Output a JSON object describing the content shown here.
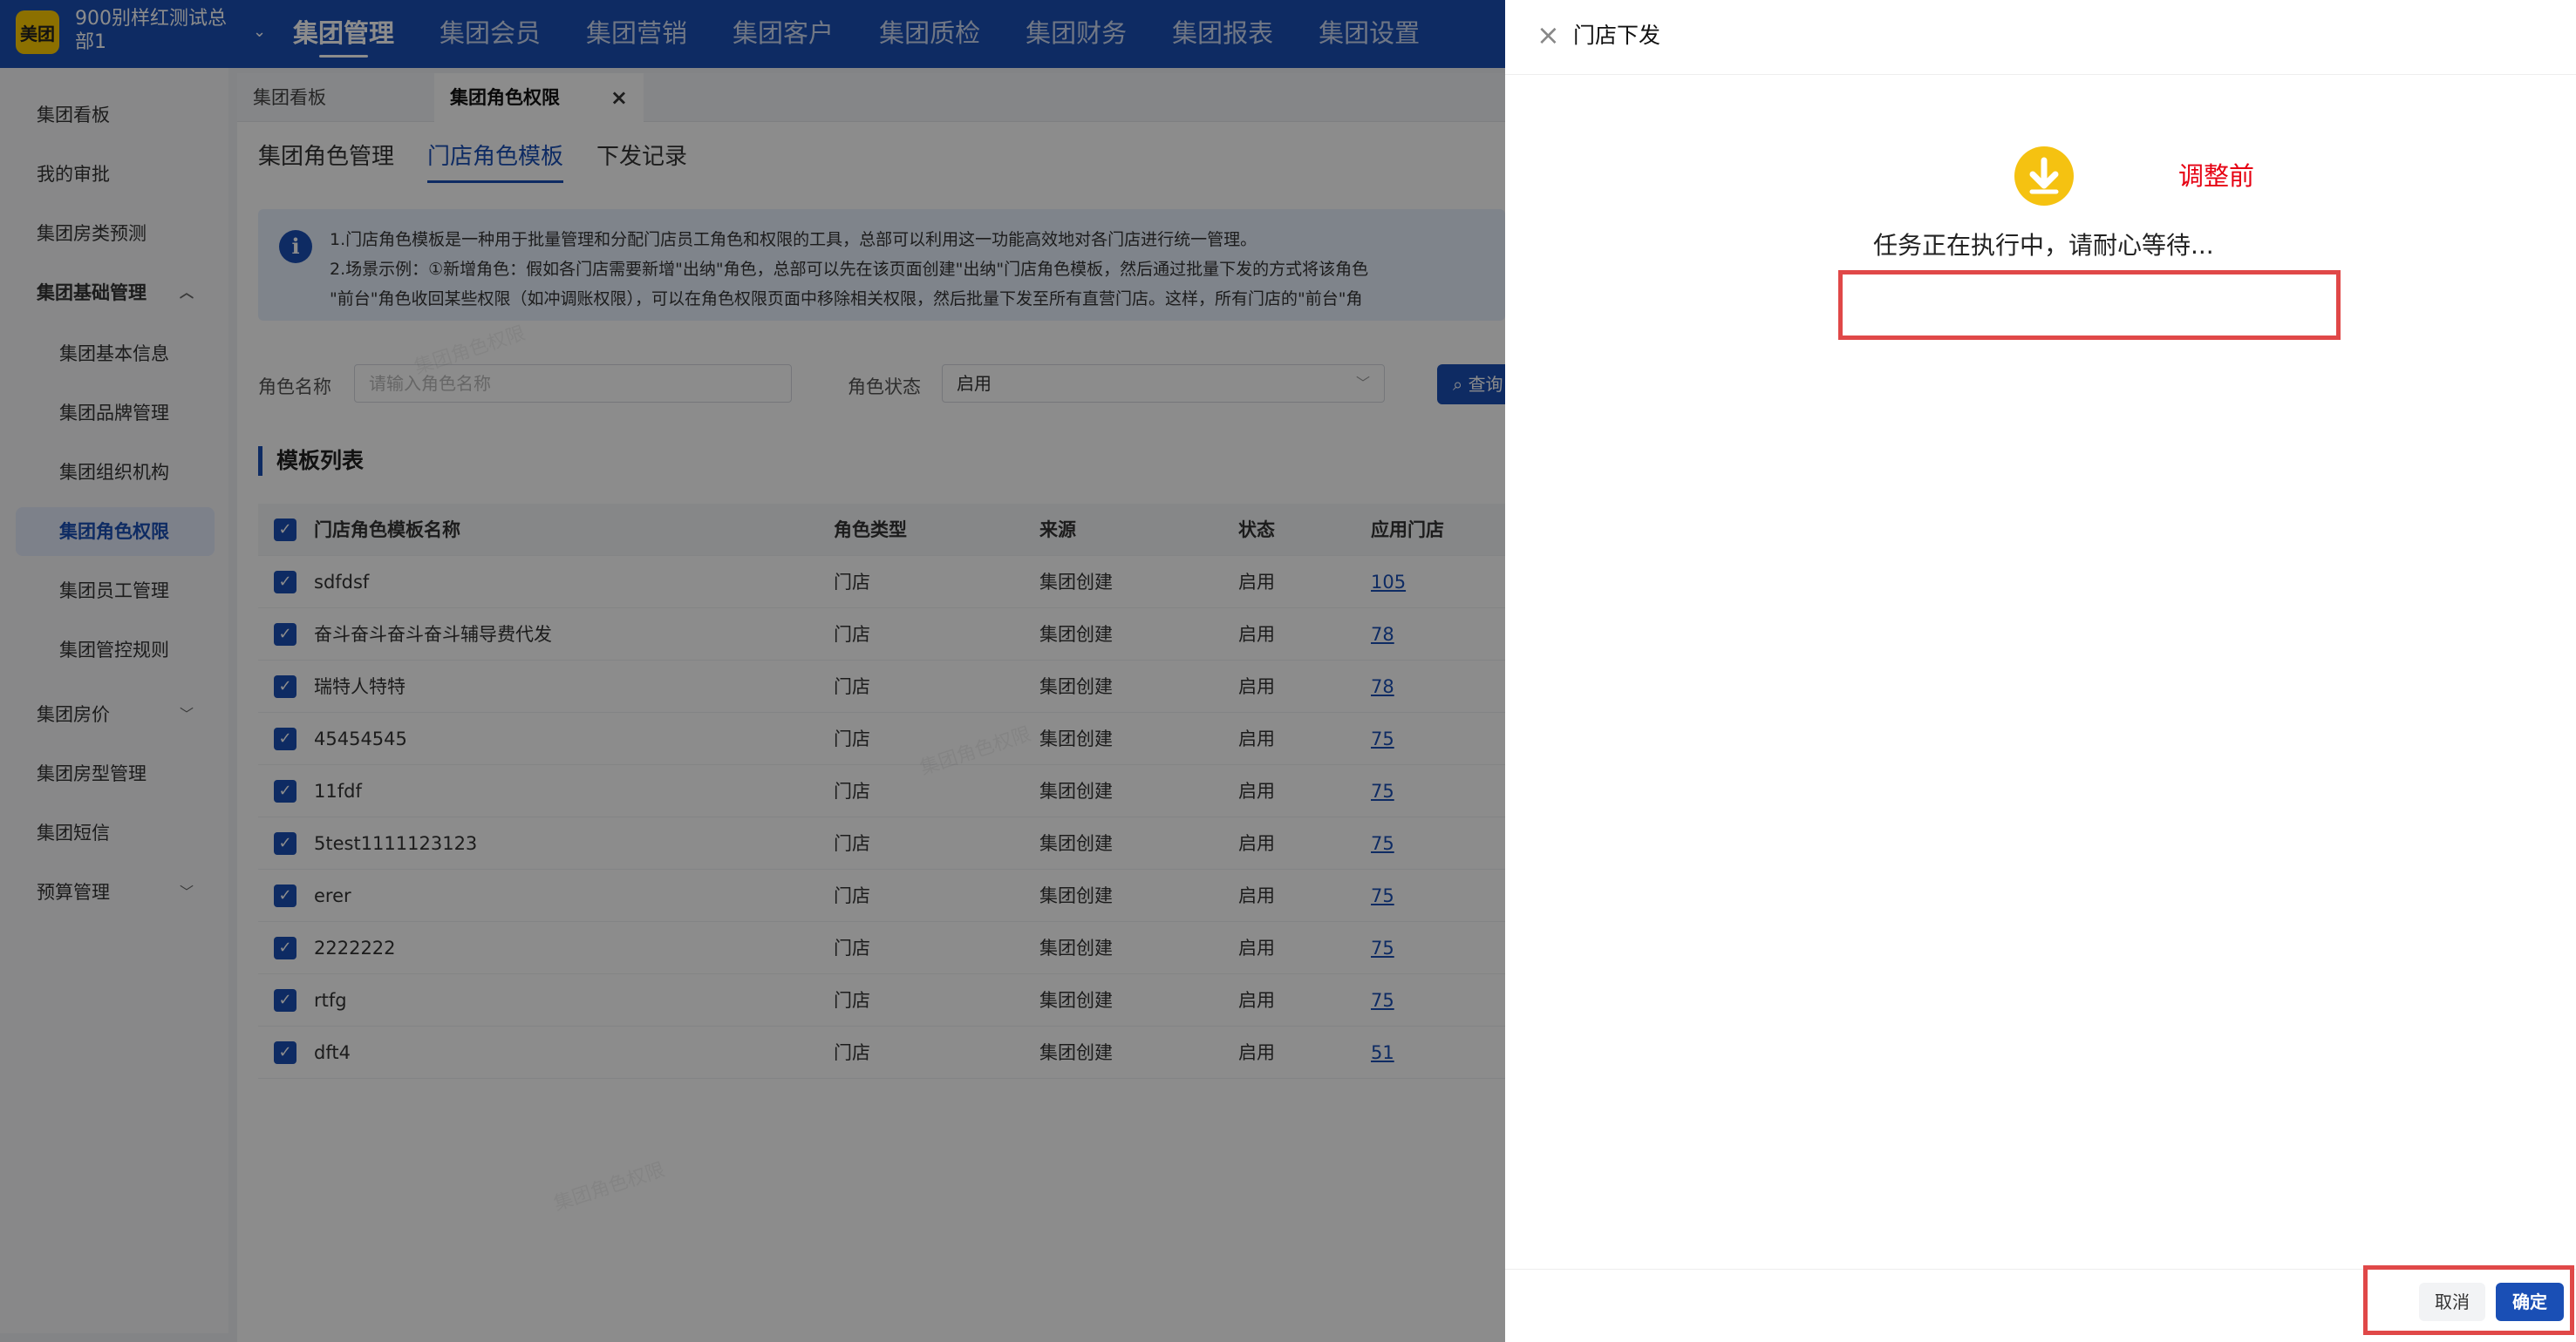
{
  "topnav": {
    "logo": "美团",
    "org_name": "900别样红测试总部1",
    "items": [
      "集团管理",
      "集团会员",
      "集团营销",
      "集团客户",
      "集团质检",
      "集团财务",
      "集团报表",
      "集团设置"
    ]
  },
  "sidebar": {
    "items": [
      "集团看板",
      "我的审批",
      "集团房类预测",
      "集团基础管理",
      "集团基本信息",
      "集团品牌管理",
      "集团组织机构",
      "集团角色权限",
      "集团员工管理",
      "集团管控规则",
      "集团房价",
      "集团房型管理",
      "集团短信",
      "预算管理"
    ]
  },
  "tabs": [
    "集团看板",
    "集团角色权限"
  ],
  "subtabs": [
    "集团角色管理",
    "门店角色模板",
    "下发记录"
  ],
  "notice": {
    "line1": "1.门店角色模板是一种用于批量管理和分配门店员工角色和权限的工具，总部可以利用这一功能高效地对各门店进行统一管理。",
    "line2": "2.场景示例：①新增角色：假如各门店需要新增\"出纳\"角色，总部可以先在该页面创建\"出纳\"门店角色模板，然后通过批量下发的方式将该角色",
    "line3": "\"前台\"角色收回某些权限（如冲调账权限），可以在角色权限页面中移除相关权限，然后批量下发至所有直营门店。这样，所有门店的\"前台\"角"
  },
  "filters": {
    "role_name_label": "角色名称",
    "role_name_placeholder": "请输入角色名称",
    "role_status_label": "角色状态",
    "role_status_value": "启用",
    "search_label": "查询"
  },
  "section_title": "模板列表",
  "table": {
    "headers": [
      "门店角色模板名称",
      "角色类型",
      "来源",
      "状态",
      "应用门店"
    ],
    "rows": [
      [
        "sdfdsf",
        "门店",
        "集团创建",
        "启用",
        "105"
      ],
      [
        "奋斗奋斗奋斗奋斗辅导费代发",
        "门店",
        "集团创建",
        "启用",
        "78"
      ],
      [
        "瑞特人特特",
        "门店",
        "集团创建",
        "启用",
        "78"
      ],
      [
        "45454545",
        "门店",
        "集团创建",
        "启用",
        "75"
      ],
      [
        "11fdf",
        "门店",
        "集团创建",
        "启用",
        "75"
      ],
      [
        "5test1111123123",
        "门店",
        "集团创建",
        "启用",
        "75"
      ],
      [
        "erer",
        "门店",
        "集团创建",
        "启用",
        "75"
      ],
      [
        "2222222",
        "门店",
        "集团创建",
        "启用",
        "75"
      ],
      [
        "rtfg",
        "门店",
        "集团创建",
        "启用",
        "75"
      ],
      [
        "dft4",
        "门店",
        "集团创建",
        "启用",
        "51"
      ]
    ]
  },
  "drawer": {
    "title": "门店下发",
    "annotation": "调整前",
    "status": "任务正在执行中，请耐心等待...",
    "cancel": "取消",
    "ok": "确定"
  },
  "colors": {
    "brand": "#1a4fb5",
    "accent": "#f5c211",
    "annotation": "#e60012"
  }
}
